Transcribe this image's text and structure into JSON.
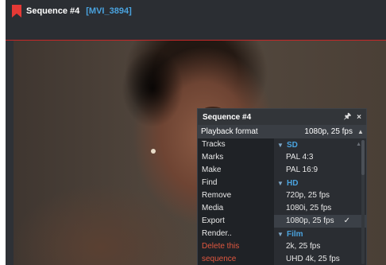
{
  "titlebar": {
    "sequence_title": "Sequence #4",
    "clip_name": "[MVI_3894]",
    "flag_color": "#e53935"
  },
  "panel": {
    "title": "Sequence #4",
    "pin_icon": "pin-icon",
    "close_icon": "close-icon",
    "pin_glyph": "🖈",
    "close_glyph": "×",
    "playback_label": "Playback format",
    "playback_value": "1080p, 25 fps",
    "menu": [
      {
        "label": "Tracks"
      },
      {
        "label": "Marks"
      },
      {
        "label": "Make"
      },
      {
        "label": "Find"
      },
      {
        "label": "Remove"
      },
      {
        "label": "Media"
      },
      {
        "label": "Export"
      },
      {
        "label": "Render.."
      },
      {
        "label": "Delete this sequence",
        "danger": true
      }
    ],
    "groups": [
      {
        "name": "SD",
        "items": [
          "PAL 4:3",
          "PAL 16:9"
        ]
      },
      {
        "name": "HD",
        "items": [
          "720p, 25 fps",
          "1080i, 25 fps",
          "1080p, 25 fps"
        ],
        "selected": "1080p, 25 fps"
      },
      {
        "name": "Film",
        "items": [
          "2k, 25 fps",
          "UHD 4k, 25 fps"
        ]
      }
    ]
  },
  "colors": {
    "accent": "#4aa3df",
    "danger": "#e0573f",
    "timeline_marker": "#c62828"
  }
}
